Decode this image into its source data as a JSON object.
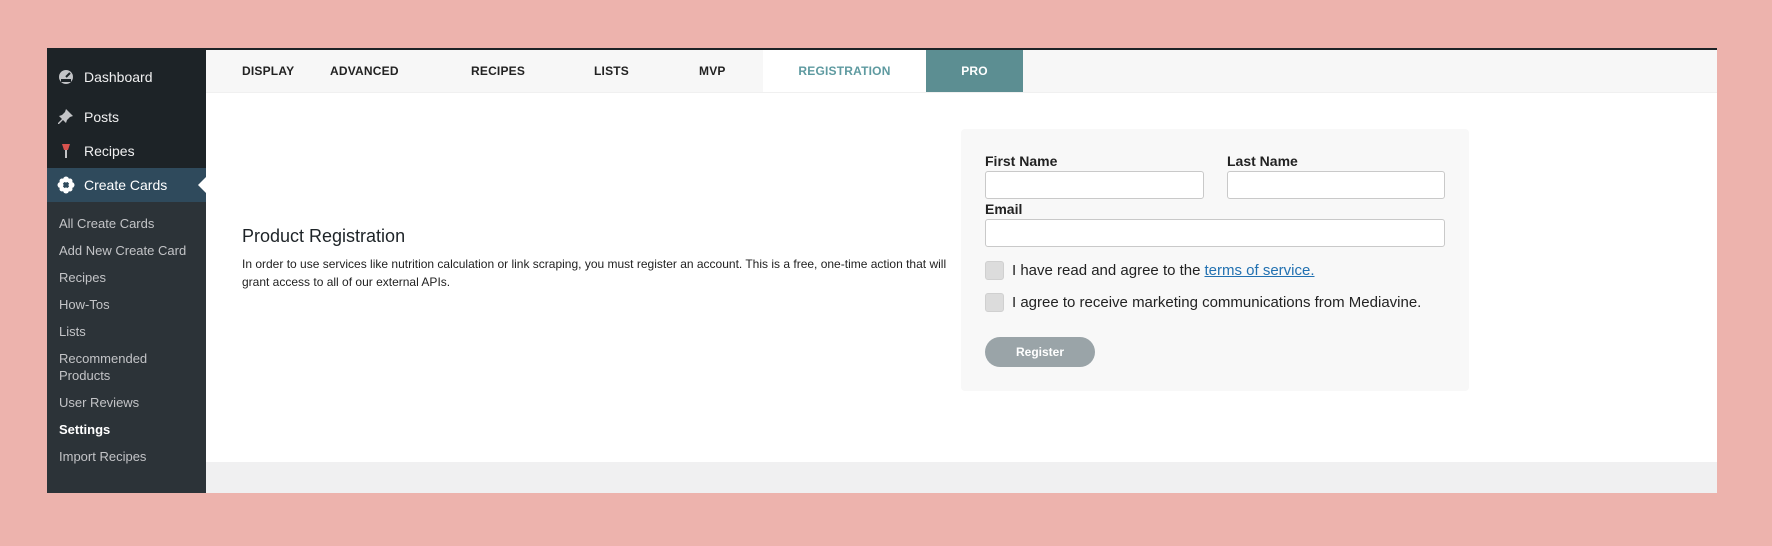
{
  "sidebar": {
    "menu": [
      {
        "label": "Dashboard",
        "icon": "dashboard-icon"
      },
      {
        "label": "Posts",
        "icon": "pin-icon"
      },
      {
        "label": "Recipes",
        "icon": "recipe-icon"
      },
      {
        "label": "Create Cards",
        "icon": "flower-icon"
      }
    ],
    "submenu": [
      "All Create Cards",
      "Add New Create Card",
      "Recipes",
      "How-Tos",
      "Lists",
      "Recommended Products",
      "User Reviews",
      "Settings",
      "Import Recipes"
    ]
  },
  "tabs": [
    "DISPLAY",
    "ADVANCED",
    "RECIPES",
    "LISTS",
    "MVP",
    "REGISTRATION",
    "PRO"
  ],
  "intro": {
    "title": "Product Registration",
    "text": "In order to use services like nutrition calculation or link scraping, you must register an account. This is a free, one-time action that will grant access to all of our external APIs."
  },
  "form": {
    "first_name_label": "First Name",
    "first_name_value": "",
    "last_name_label": "Last Name",
    "last_name_value": "",
    "email_label": "Email",
    "email_value": "",
    "tos_text": "I have read and agree to the",
    "tos_link": "terms of service.",
    "marketing_text": "I agree to receive marketing communications from Mediavine.",
    "register_label": "Register"
  },
  "colors": {
    "background": "#edb3ad",
    "active_tab_text": "#5e9aa0",
    "pro_tab_bg": "#5c8e92",
    "link": "#2271b1",
    "sidebar_active": "#2f4a5c"
  }
}
